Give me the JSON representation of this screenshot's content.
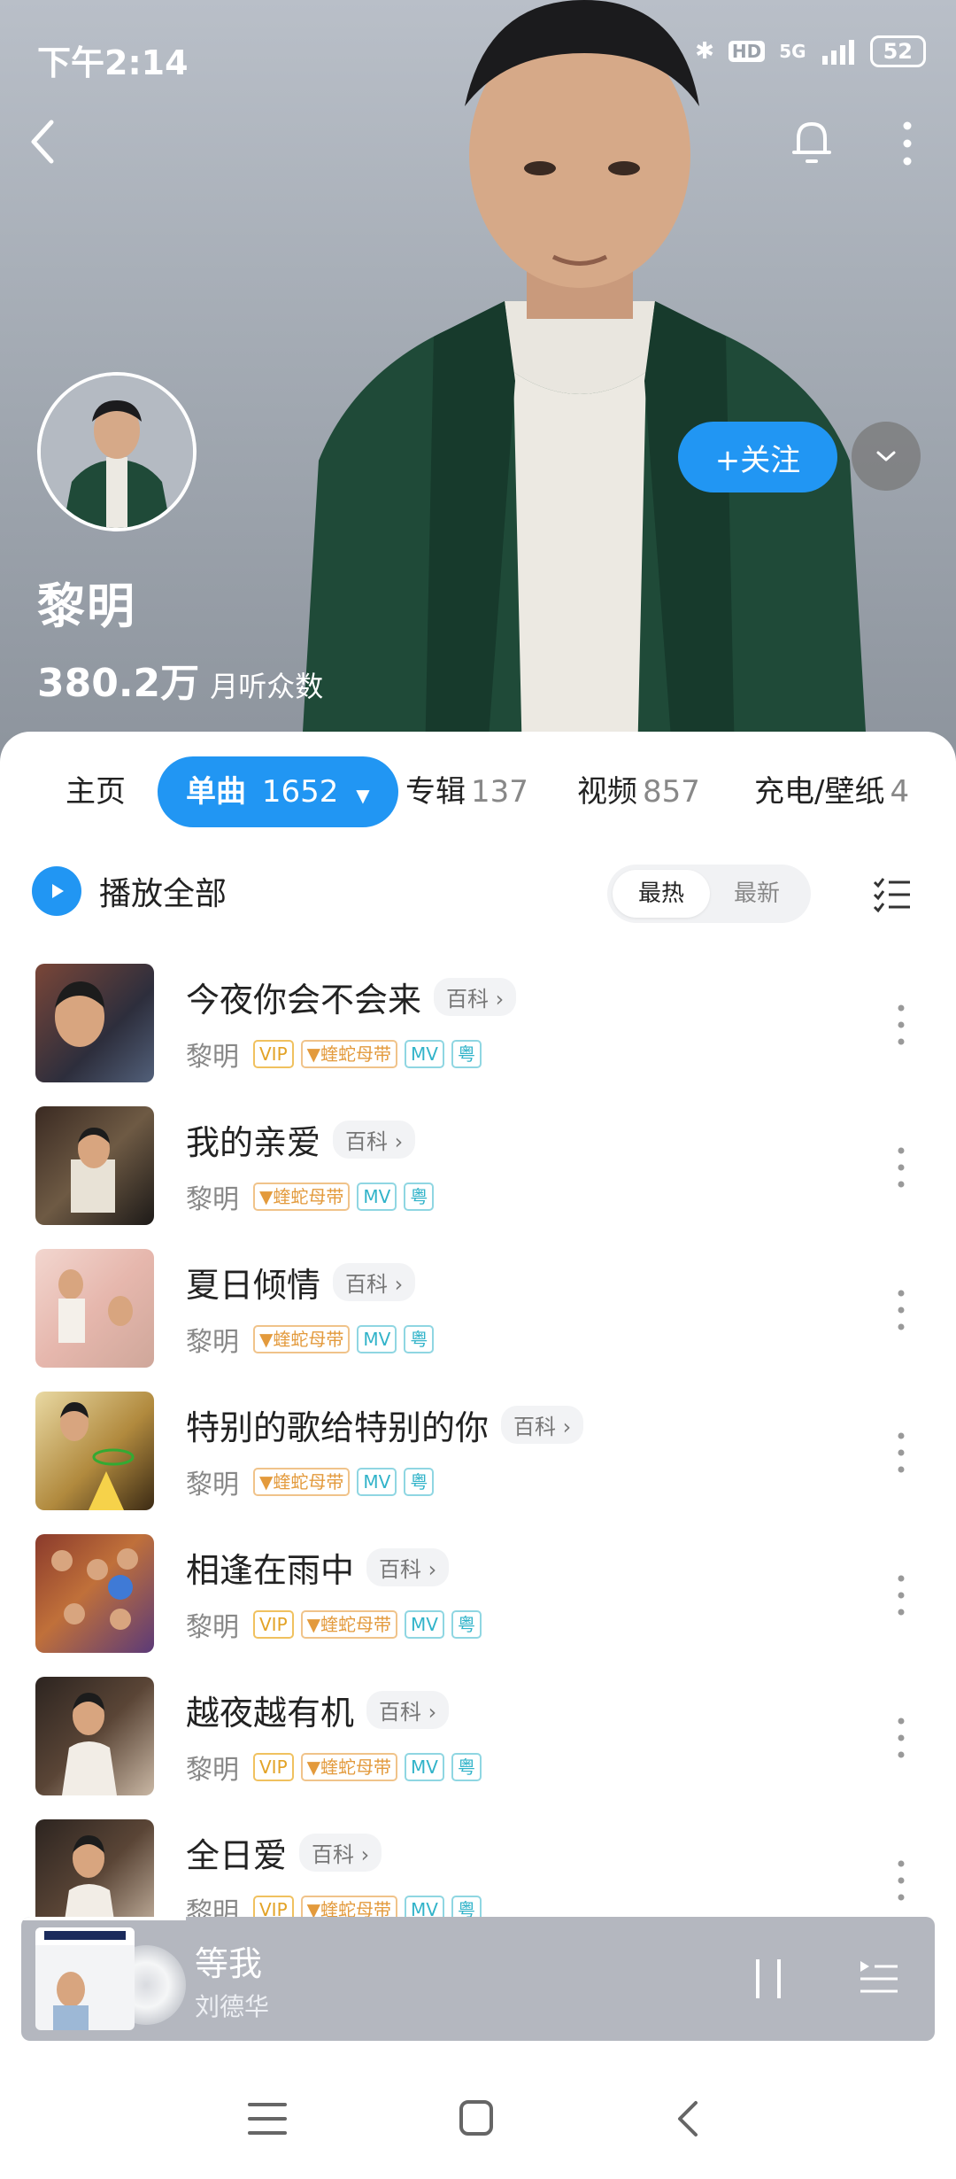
{
  "status_bar": {
    "time": "下午2:14",
    "network": "5G",
    "hd_label": "HD",
    "battery": "52"
  },
  "header": {
    "back_icon": "chevron-left-icon",
    "bell_icon": "bell-icon",
    "more_icon": "more-vertical-icon"
  },
  "artist": {
    "name": "黎明",
    "monthly_listeners": "380.2万",
    "monthly_listeners_label": "月听众数",
    "follow_label": "+关注"
  },
  "tabs": [
    {
      "label": "主页",
      "count": ""
    },
    {
      "label": "单曲",
      "count": "1652"
    },
    {
      "label": "专辑",
      "count": "137"
    },
    {
      "label": "视频",
      "count": "857"
    },
    {
      "label": "充电/壁纸",
      "count": "4"
    }
  ],
  "toolbar": {
    "play_all_label": "播放全部",
    "sort_hot": "最热",
    "sort_new": "最新"
  },
  "songs": [
    {
      "title": "今夜你会不会来",
      "wiki": "百科",
      "artist": "黎明",
      "tags": [
        "VIP",
        "蝰蛇母带",
        "MV",
        "粤"
      ]
    },
    {
      "title": "我的亲爱",
      "wiki": "百科",
      "artist": "黎明",
      "tags": [
        "蝰蛇母带",
        "MV",
        "粤"
      ]
    },
    {
      "title": "夏日倾情",
      "wiki": "百科",
      "artist": "黎明",
      "tags": [
        "蝰蛇母带",
        "MV",
        "粤"
      ]
    },
    {
      "title": "特别的歌给特别的你",
      "wiki": "百科",
      "artist": "黎明",
      "tags": [
        "蝰蛇母带",
        "MV",
        "粤"
      ]
    },
    {
      "title": "相逢在雨中",
      "wiki": "百科",
      "artist": "黎明",
      "tags": [
        "VIP",
        "蝰蛇母带",
        "MV",
        "粤"
      ]
    },
    {
      "title": "越夜越有机",
      "wiki": "百科",
      "artist": "黎明",
      "tags": [
        "VIP",
        "蝰蛇母带",
        "MV",
        "粤"
      ]
    },
    {
      "title": "全日爱",
      "wiki": "百科",
      "artist": "黎明",
      "tags": [
        "VIP",
        "蝰蛇母带",
        "MV",
        "粤"
      ]
    }
  ],
  "mini_player": {
    "title": "等我",
    "artist": "刘德华",
    "progress": 0.18
  },
  "colors": {
    "accent": "#2196f3",
    "vip": "#e3a326",
    "mv": "#31b3c9"
  }
}
